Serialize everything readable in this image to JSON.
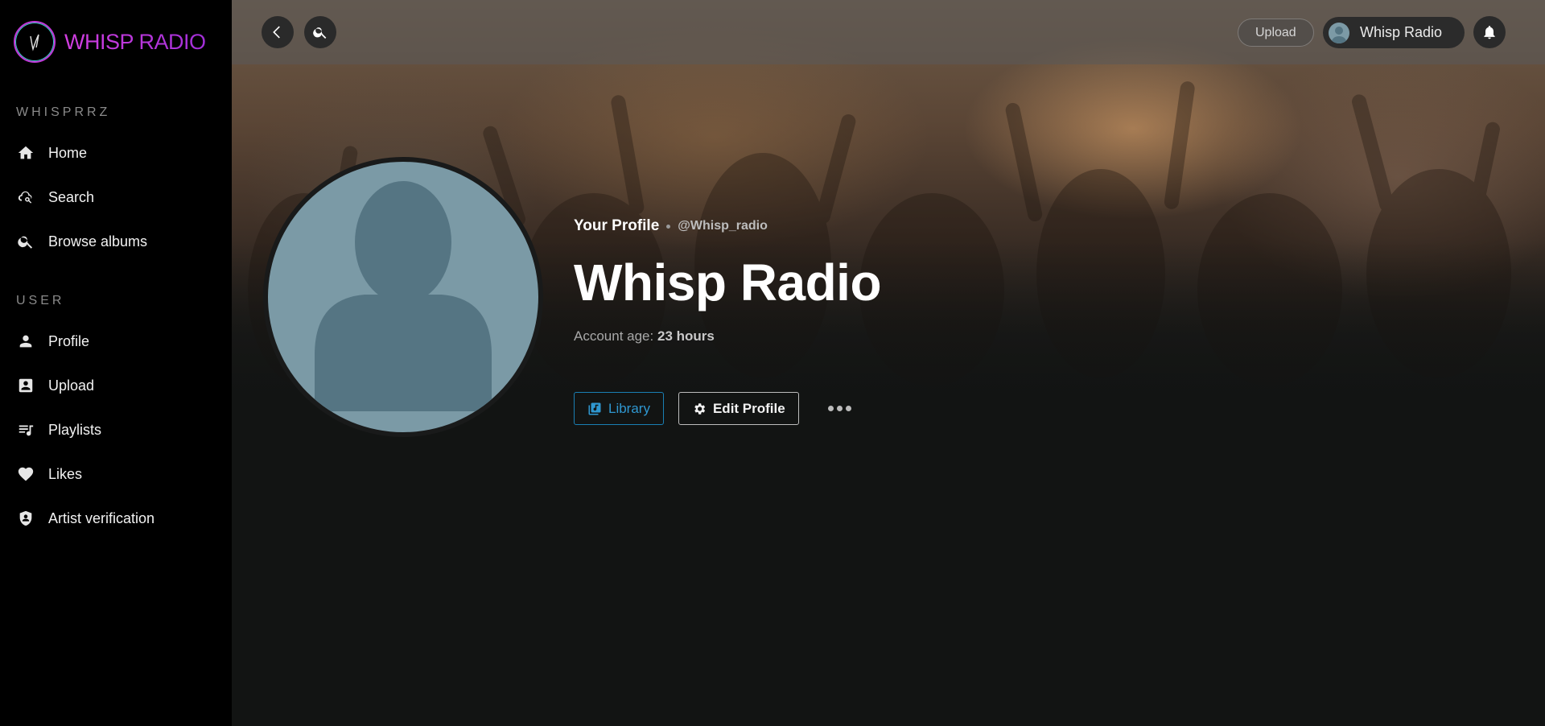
{
  "app": {
    "brand": "WHISP RADIO"
  },
  "sidebar": {
    "sections": [
      {
        "title": "WHISPRRZ",
        "items": [
          {
            "label": "Home",
            "icon": "home-icon"
          },
          {
            "label": "Search",
            "icon": "search-cloud-icon"
          },
          {
            "label": "Browse albums",
            "icon": "search-icon"
          }
        ]
      },
      {
        "title": "USER",
        "items": [
          {
            "label": "Profile",
            "icon": "person-icon"
          },
          {
            "label": "Upload",
            "icon": "upload-box-icon"
          },
          {
            "label": "Playlists",
            "icon": "playlist-icon"
          },
          {
            "label": "Likes",
            "icon": "heart-icon"
          },
          {
            "label": "Artist verification",
            "icon": "shield-icon"
          }
        ]
      }
    ]
  },
  "topbar": {
    "back_icon": "back-chevron-icon",
    "search_icon": "search-icon",
    "upload_label": "Upload",
    "user_label": "Whisp Radio",
    "bell_icon": "bell-icon"
  },
  "profile": {
    "eyebrow": "Your Profile",
    "handle": "@Whisp_radio",
    "name": "Whisp Radio",
    "account_age_label": "Account age:",
    "account_age_value": "23 hours"
  },
  "actions": {
    "library_label": "Library",
    "edit_label": "Edit Profile",
    "more_icon": "more-dots-icon"
  },
  "colors": {
    "brand": "#c238d9",
    "library_accent": "#2f97d0",
    "sidebar_bg": "#000000",
    "page_bg": "#121413",
    "avatar_bg": "#7b9aa6"
  }
}
